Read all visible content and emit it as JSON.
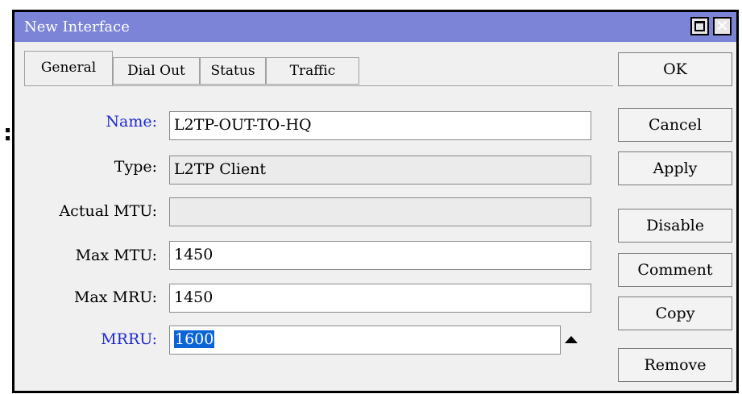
{
  "window": {
    "title": "New Interface"
  },
  "tabs": [
    {
      "label": "General"
    },
    {
      "label": "Dial Out"
    },
    {
      "label": "Status"
    },
    {
      "label": "Traffic"
    }
  ],
  "fields": {
    "name": {
      "label": "Name:",
      "value": "L2TP-OUT-TO-HQ"
    },
    "type": {
      "label": "Type:",
      "value": "L2TP Client"
    },
    "actual_mtu": {
      "label": "Actual MTU:",
      "value": ""
    },
    "max_mtu": {
      "label": "Max MTU:",
      "value": "1450"
    },
    "max_mru": {
      "label": "Max MRU:",
      "value": "1450"
    },
    "mrru": {
      "label": "MRRU:",
      "value": "1600"
    }
  },
  "buttons": {
    "ok": "OK",
    "cancel": "Cancel",
    "apply": "Apply",
    "disable": "Disable",
    "comment": "Comment",
    "copy": "Copy",
    "remove": "Remove"
  },
  "colors": {
    "titlebar": "#7c84d8",
    "label_highlight": "#1e28d8",
    "selection": "#0a64d8"
  },
  "icons": [
    "maximize-icon",
    "close-icon",
    "collapse-arrow-icon"
  ]
}
